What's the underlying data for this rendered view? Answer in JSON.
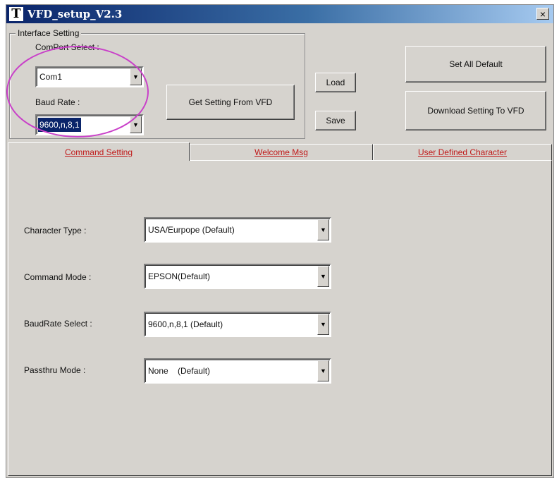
{
  "window": {
    "title": "VFD_setup_V2.3",
    "icon_letter": "T",
    "close_glyph": "×"
  },
  "interface": {
    "legend": "Interface Setting",
    "comport_label": "ComPort Select :",
    "comport_value": "Com1",
    "baud_label": "Baud Rate :",
    "baud_value": "9600,n,8,1"
  },
  "buttons": {
    "get_setting": "Get Setting From VFD",
    "load": "Load",
    "save": "Save",
    "set_all_default": "Set All Default",
    "download": "Download Setting To VFD"
  },
  "tabs": [
    {
      "label": "Command Setting",
      "active": true
    },
    {
      "label": "Welcome Msg",
      "active": false
    },
    {
      "label": "User Defined Character",
      "active": false
    }
  ],
  "command_setting": {
    "character_type": {
      "label": "Character Type :",
      "value": "USA/Eurpope (Default)"
    },
    "command_mode": {
      "label": "Command Mode :",
      "value": "EPSON(Default)"
    },
    "baudrate_select": {
      "label": "BaudRate Select :",
      "value": "9600,n,8,1 (Default)"
    },
    "passthru_mode": {
      "label": "Passthru Mode :",
      "value": "None    (Default)"
    }
  },
  "colors": {
    "highlight_circle": "#c940c9",
    "tab_text": "#c01818",
    "titlebar": "#0a246a"
  }
}
